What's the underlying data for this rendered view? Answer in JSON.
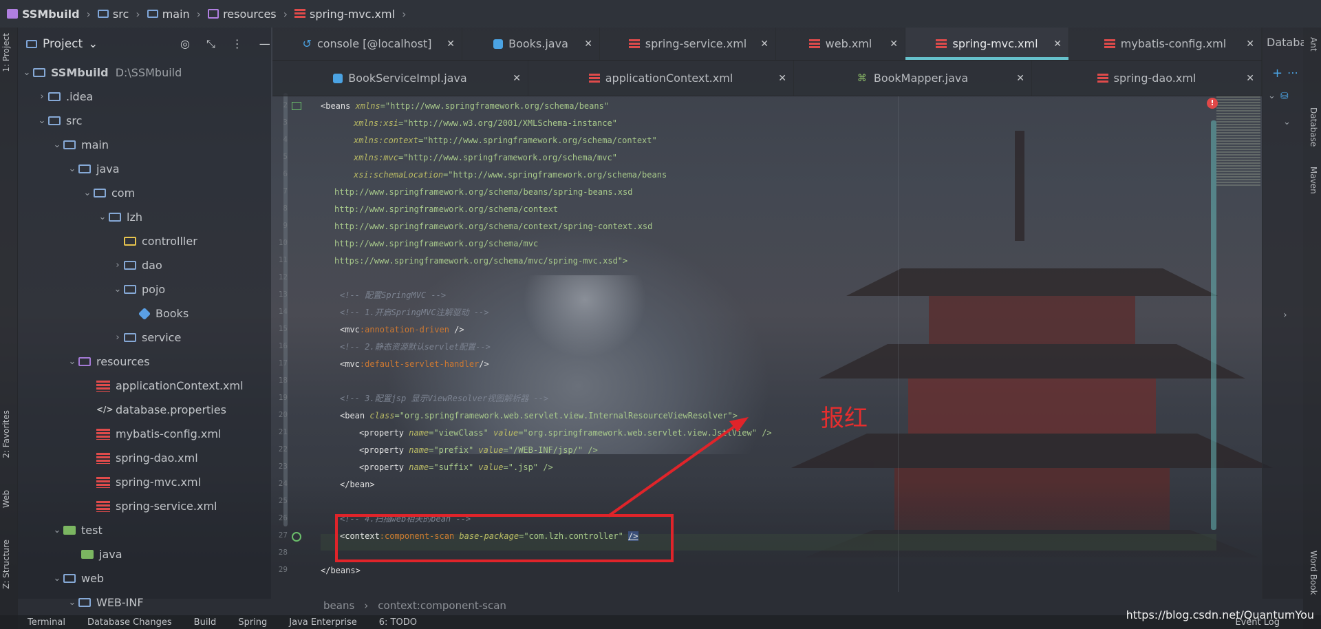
{
  "navbar": {
    "crumbs": [
      "SSMbuild",
      "src",
      "main",
      "resources",
      "spring-mvc.xml"
    ]
  },
  "left_strip": {
    "tabs": [
      "1: Project",
      "2: Favorites",
      "Web",
      "Z: Structure"
    ]
  },
  "right_strip": {
    "tabs": [
      "Ant",
      "Database",
      "Maven",
      "Word Book"
    ]
  },
  "project": {
    "title": "Project",
    "tree": [
      {
        "label": "SSMbuild",
        "path": "D:\\SSMbuild"
      },
      {
        "label": ".idea"
      },
      {
        "label": "src"
      },
      {
        "label": "main"
      },
      {
        "label": "java"
      },
      {
        "label": "com"
      },
      {
        "label": "lzh"
      },
      {
        "label": "controlller"
      },
      {
        "label": "dao"
      },
      {
        "label": "pojo"
      },
      {
        "label": "Books"
      },
      {
        "label": "service"
      },
      {
        "label": "resources"
      },
      {
        "label": "applicationContext.xml"
      },
      {
        "label": "database.properties"
      },
      {
        "label": "mybatis-config.xml"
      },
      {
        "label": "spring-dao.xml"
      },
      {
        "label": "spring-mvc.xml"
      },
      {
        "label": "spring-service.xml"
      },
      {
        "label": "test"
      },
      {
        "label": "java"
      },
      {
        "label": "web"
      },
      {
        "label": "WEB-INF"
      }
    ]
  },
  "tabs_row1": [
    "console [@localhost]",
    "Books.java",
    "spring-service.xml",
    "web.xml",
    "spring-mvc.xml",
    "mybatis-config.xml"
  ],
  "tabs_row2": [
    "BookServiceImpl.java",
    "applicationContext.xml",
    "BookMapper.java",
    "spring-dao.xml"
  ],
  "db_panel_title": "Database",
  "code": {
    "line_numbers": [
      "2",
      "3",
      "4",
      "5",
      "6",
      "7",
      "8",
      "9",
      "10",
      "11",
      "12",
      "13",
      "14",
      "15",
      "16",
      "17",
      "18",
      "19",
      "20",
      "21",
      "22",
      "23",
      "24",
      "25",
      "26",
      "27",
      "28",
      "29"
    ],
    "lines": {
      "l2a": "<beans ",
      "l2b": "xmlns",
      "l2c": "=\"http://www.springframework.org/schema/beans\"",
      "l3a": "xmlns:",
      "l3b": "xsi",
      "l3c": "=\"http://www.w3.org/2001/XMLSchema-instance\"",
      "l4a": "xmlns:",
      "l4b": "context",
      "l4c": "=\"http://www.springframework.org/schema/context\"",
      "l5a": "xmlns:",
      "l5b": "mvc",
      "l5c": "=\"http://www.springframework.org/schema/mvc\"",
      "l6a": "xsi:",
      "l6b": "schemaLocation",
      "l6c": "=\"http://www.springframework.org/schema/beans",
      "l7": "http://www.springframework.org/schema/beans/spring-beans.xsd",
      "l8": "http://www.springframework.org/schema/context",
      "l9": "http://www.springframework.org/schema/context/spring-context.xsd",
      "l10": "http://www.springframework.org/schema/mvc",
      "l11": "https://www.springframework.org/schema/mvc/spring-mvc.xsd\">",
      "l13": "<!-- 配置SpringMVC -->",
      "l14": "<!-- 1.开启SpringMVC注解驱动 -->",
      "l15a": "<mvc",
      "l15b": ":annotation-driven",
      "l15c": " />",
      "l16": "<!-- 2.静态资源默认servlet配置-->",
      "l17a": "<mvc",
      "l17b": ":default-servlet-handler",
      "l17c": "/>",
      "l19": "<!-- 3.配置jsp 显示ViewResolver视图解析器 -->",
      "l20a": "<bean ",
      "l20b": "class",
      "l20c": "=\"org.springframework.web.servlet.view.InternalResourceViewResolver\">",
      "l21a": "<property ",
      "l21b": "name",
      "l21c": "=\"viewClass\" ",
      "l21d": "value",
      "l21e": "=\"org.springframework.web.servlet.view.JstlView\" />",
      "l22a": "<property ",
      "l22b": "name",
      "l22c": "=\"prefix\" ",
      "l22d": "value",
      "l22e": "=\"/WEB-INF/jsp/\" />",
      "l23a": "<property ",
      "l23b": "name",
      "l23c": "=\"suffix\" ",
      "l23d": "value",
      "l23e": "=\".jsp\" />",
      "l24": "</bean>",
      "l26": "<!-- 4.扫描web相关的bean -->",
      "l27a": "<context",
      "l27b": ":component-scan ",
      "l27c": "base-package",
      "l27d": "=\"com.lzh.controller\" ",
      "l27e": "/>",
      "l29": "</beans>"
    }
  },
  "editor_breadcrumb": [
    "beans",
    "context:component-scan"
  ],
  "annotation": {
    "label": "报红",
    "color": "#e0242a"
  },
  "statusbar": [
    "Terminal",
    "Database Changes",
    "Build",
    "Spring",
    "Java Enterprise",
    "6: TODO",
    "Event Log"
  ],
  "watermark": "https://blog.csdn.net/QuantumYou"
}
